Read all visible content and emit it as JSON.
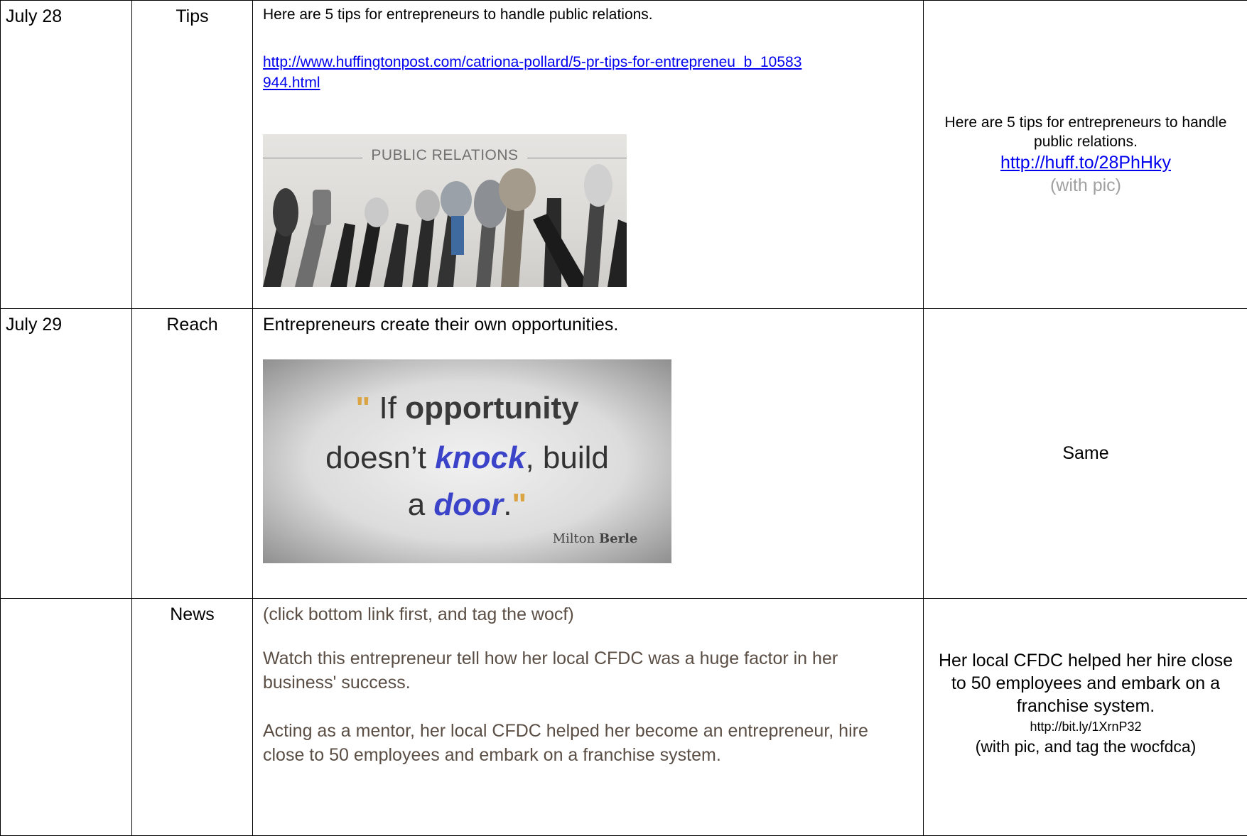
{
  "rows": [
    {
      "date": "July 28",
      "category": "Tips",
      "content_text": "Here are 5 tips for entrepreneurs to handle public relations.",
      "content_link": "http://www.huffingtonpost.com/catriona-pollard/5-pr-tips-for-entrepreneu_b_10583944.html",
      "image_caption": "PUBLIC RELATIONS",
      "right_text": "Here are 5 tips for entrepreneurs to handle public relations.",
      "right_link": "http://huff.to/28PhHky",
      "right_note": "(with pic)"
    },
    {
      "date": "July 29",
      "category": "Reach",
      "content_text": "Entrepreneurs create their own opportunities.",
      "quote": {
        "w_if": "If",
        "w_opportunity": "opportunity",
        "w_doesnt": "doesn’t",
        "w_knock": "knock",
        "w_build": ", build",
        "w_a": "a",
        "w_door": "door",
        "w_period": ".",
        "author_first": "Milton",
        "author_last": "Berle"
      },
      "right_text": "Same"
    },
    {
      "date": "",
      "category": "News",
      "content_note": "(click bottom link first, and tag the wocf)",
      "content_p1": "Watch this entrepreneur tell how her local CFDC was a huge factor in her business' success.",
      "content_p2": "Acting as a mentor, her local CFDC helped her become an entrepreneur, hire close to 50 employees and embark on a franchise system.",
      "right_text": "Her local CFDC helped her hire close to 50 employees and embark on a franchise system.",
      "right_link": "http://bit.ly/1XrnP32",
      "right_note": "(with pic, and tag the wocfdca)"
    }
  ],
  "colors": {
    "link": "#0000ee",
    "note_grey": "#a0a0a0",
    "news_text": "#5a4e45",
    "quote_blue": "#3b43c9",
    "quote_mark": "#d9a441"
  },
  "icons": [
    "microphones-photo",
    "crumpled-paper-quote-photo"
  ]
}
